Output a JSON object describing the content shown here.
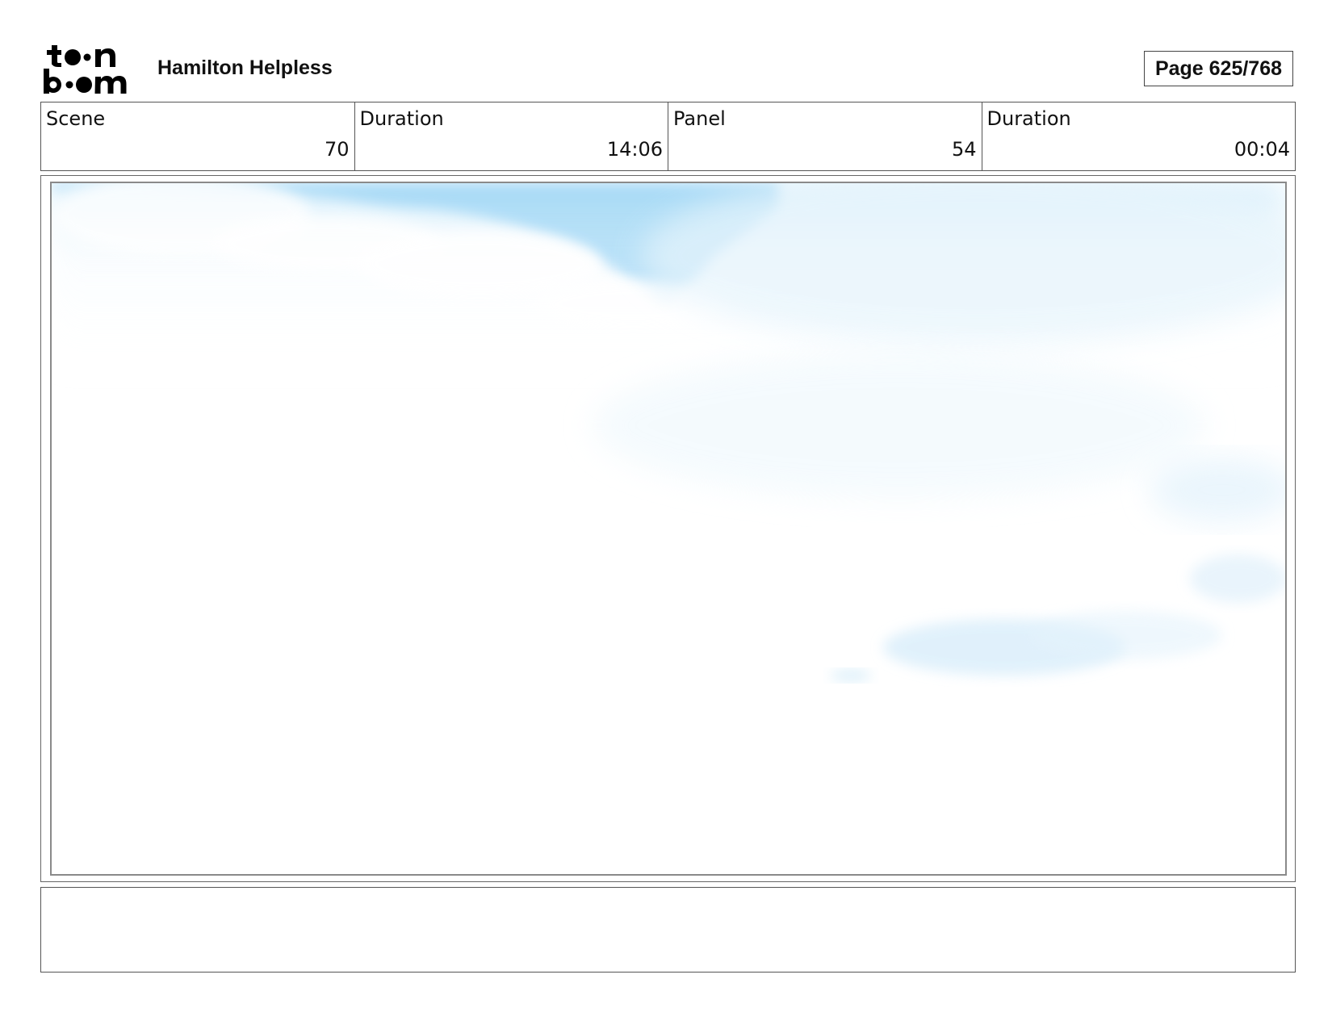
{
  "logo": {
    "line1": "toon",
    "line2": "boom"
  },
  "header": {
    "project_title": "Hamilton Helpless",
    "page_indicator": "Page 625/768"
  },
  "info": {
    "scene": {
      "label": "Scene",
      "value": "70"
    },
    "scene_duration": {
      "label": "Duration",
      "value": "14:06"
    },
    "panel": {
      "label": "Panel",
      "value": "54"
    },
    "panel_duration": {
      "label": "Duration",
      "value": "00:04"
    }
  },
  "panel_image": {
    "sky_color": "#9fd6f5",
    "cloud_color": "#ffffff"
  },
  "caption": {
    "text": ""
  }
}
